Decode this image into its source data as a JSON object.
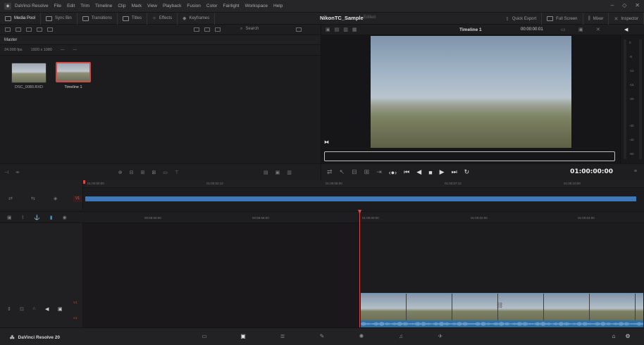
{
  "menubar": {
    "items": [
      "DaVinci Resolve",
      "File",
      "Edit",
      "Trim",
      "Timeline",
      "Clip",
      "Mark",
      "View",
      "Playback",
      "Fusion",
      "Color",
      "Fairlight",
      "Workspace",
      "Help"
    ],
    "window_controls": [
      "minimize-icon",
      "maximize-icon",
      "close-icon"
    ]
  },
  "toolbar": {
    "left": [
      "Media Pool",
      "Sync Bin",
      "Transitions",
      "Titles",
      "Effects",
      "Keyframes"
    ],
    "project_title": "NikonTC_Sample",
    "project_status": "Edited",
    "right": [
      "Quick Export",
      "Full Screen",
      "Mixer",
      "Inspector"
    ]
  },
  "media_pool": {
    "search_label": "Search",
    "bin_name": "Master",
    "clip_info": [
      "24.000 fps",
      "1920 x 1080",
      "—",
      "—"
    ],
    "items": [
      {
        "label": "DSC_0080.RXD",
        "selected": false
      },
      {
        "label": "Timeline 1",
        "selected": true
      }
    ]
  },
  "viewer": {
    "timeline_name": "Timeline 1",
    "timecode_top": "00:00:00:01",
    "timecode_main": "01:00:00:00",
    "meter_ticks": [
      "0",
      "-5",
      "-10",
      "-15",
      "-20",
      "-30",
      "-40",
      "-50"
    ]
  },
  "upper_timeline": {
    "ruler": [
      "01:00:00:00",
      "01:00:02:12",
      "01:00:05:00",
      "01:00:07:12",
      "01:00:10:00"
    ],
    "track": "V1"
  },
  "lower_timeline": {
    "ruler_left": [
      "00:59:56:00",
      "00:59:58:00"
    ],
    "ruler": [
      "01:00:00:00",
      "01:00:02:00",
      "01:00:04:00"
    ],
    "tracks": [
      "V1",
      "A1"
    ]
  },
  "pagebar": {
    "brand": "DaVinci Resolve 20",
    "pages": [
      "media-icon",
      "cut-icon",
      "edit-icon",
      "fusion-icon",
      "color-icon",
      "fairlight-icon",
      "deliver-icon"
    ],
    "active_page": "cut-icon"
  },
  "colors": {
    "accent_red": "#d04848",
    "clip_blue": "#3d78b8",
    "background": "#1c1c1e"
  }
}
